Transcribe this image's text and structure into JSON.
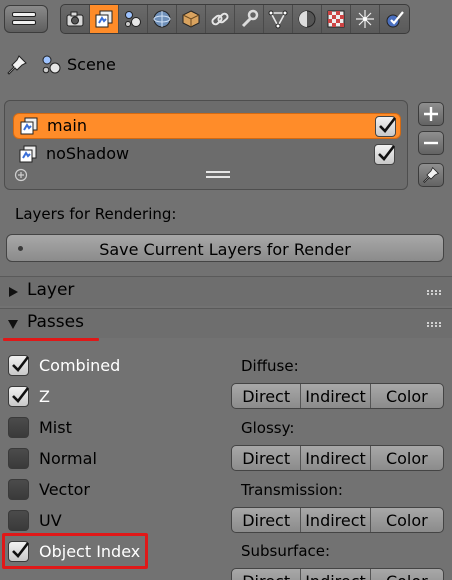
{
  "tabs": [
    {
      "name": "render-tab",
      "icon": "camera-icon"
    },
    {
      "name": "render-layers-tab",
      "icon": "render-layers-icon"
    },
    {
      "name": "scene-tab",
      "icon": "scene-icon"
    },
    {
      "name": "world-tab",
      "icon": "world-icon"
    },
    {
      "name": "object-tab",
      "icon": "cube-icon"
    },
    {
      "name": "constraints-tab",
      "icon": "chain-link-icon"
    },
    {
      "name": "modifiers-tab",
      "icon": "wrench-icon"
    },
    {
      "name": "data-tab",
      "icon": "vertex-icon"
    },
    {
      "name": "material-tab",
      "icon": "material-sphere-icon"
    },
    {
      "name": "texture-tab",
      "icon": "checker-icon"
    },
    {
      "name": "particles-tab",
      "icon": "particles-icon"
    },
    {
      "name": "physics-tab",
      "icon": "physics-icon"
    }
  ],
  "active_tab": "render-layers-tab",
  "context": {
    "scene_label": "Scene"
  },
  "render_layers": {
    "items": [
      {
        "label": "main",
        "enabled": true,
        "selected": true
      },
      {
        "label": "noShadow",
        "enabled": true,
        "selected": false
      }
    ]
  },
  "layers_for_rendering_label": "Layers for Rendering:",
  "save_layers_button": "Save Current Layers for Render",
  "panels": {
    "layer": {
      "title": "Layer",
      "expanded": false
    },
    "passes": {
      "title": "Passes",
      "expanded": true
    }
  },
  "passes": [
    {
      "label": "Combined",
      "checked": true
    },
    {
      "label": "Z",
      "checked": true
    },
    {
      "label": "Mist",
      "checked": false
    },
    {
      "label": "Normal",
      "checked": false
    },
    {
      "label": "Vector",
      "checked": false
    },
    {
      "label": "UV",
      "checked": false
    },
    {
      "label": "Object Index",
      "checked": true
    }
  ],
  "light_passes": [
    {
      "heading": "Diffuse:",
      "buttons": [
        "Direct",
        "Indirect",
        "Color"
      ]
    },
    {
      "heading": "Glossy:",
      "buttons": [
        "Direct",
        "Indirect",
        "Color"
      ]
    },
    {
      "heading": "Transmission:",
      "buttons": [
        "Direct",
        "Indirect",
        "Color"
      ]
    },
    {
      "heading": "Subsurface:",
      "buttons": [
        "Direct",
        "Indirect",
        "Color"
      ]
    }
  ],
  "colors": {
    "accent_orange": "#ff8c29",
    "annotation_red": "#e01818",
    "panel_bg": "#727272"
  }
}
